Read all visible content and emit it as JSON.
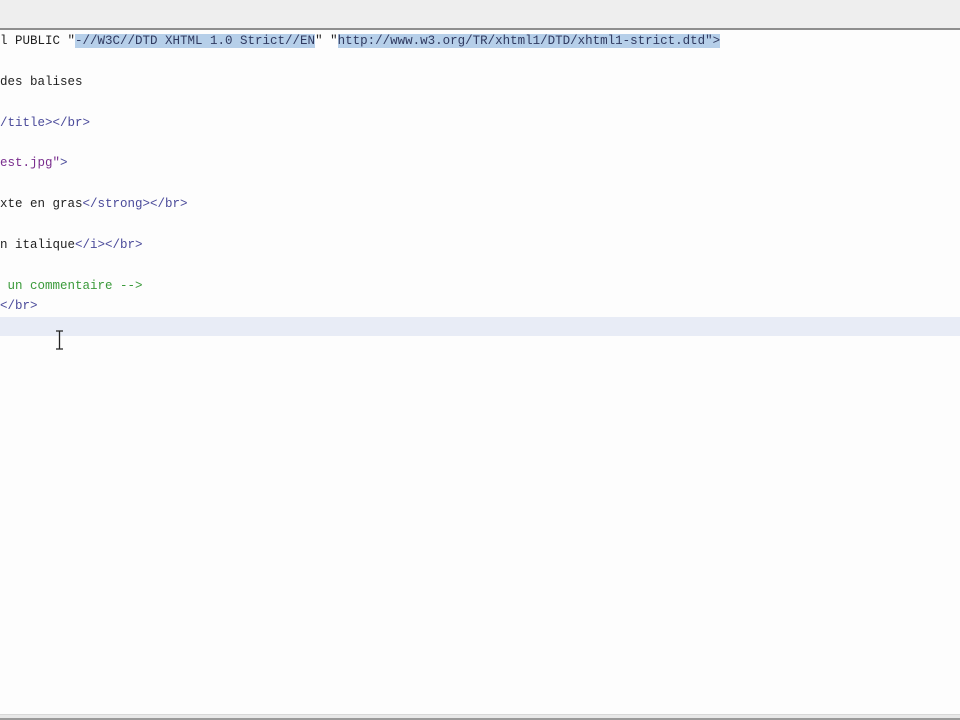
{
  "editor": {
    "lines": {
      "doctype_prefix": "l PUBLIC \"",
      "doctype_fpi": "-//W3C//DTD XHTML 1.0 Strict//EN",
      "doctype_mid": "\" \"",
      "doctype_url": "http://www.w3.org/TR/xhtml1/DTD/xhtml1-strict.dtd",
      "doctype_q": "\"",
      "doctype_end": ">",
      "title_text": "des balises",
      "title_close": "/title></br>",
      "img_src": "est.jpg\"",
      "img_end": ">",
      "strong_text": "xte en gras",
      "strong_close": "</strong></br>",
      "italic_text": "n italique",
      "italic_close": "</i></br>",
      "comment": " un commentaire -->",
      "br_close": "</br>"
    }
  }
}
